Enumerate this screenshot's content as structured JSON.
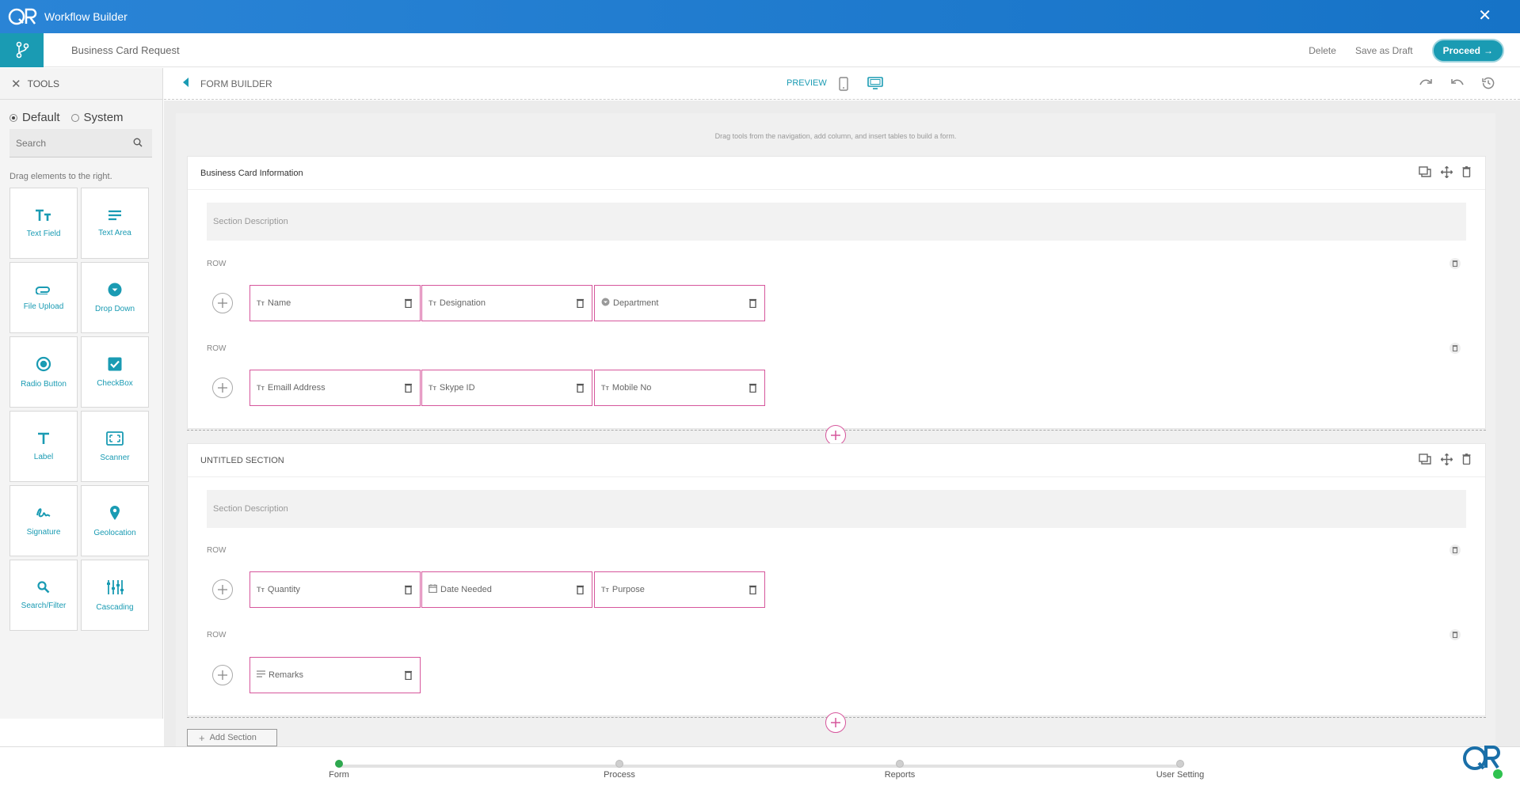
{
  "app": {
    "title": "Workflow Builder"
  },
  "header": {
    "form_name": "Business Card Request",
    "delete_label": "Delete",
    "draft_label": "Save as Draft",
    "proceed_label": "Proceed"
  },
  "tools": {
    "title": "TOOLS",
    "mode_default": "Default",
    "mode_system": "System",
    "search_placeholder": "Search",
    "hint": "Drag elements to the right.",
    "items": [
      {
        "label": "Text Field",
        "icon": "text-field-icon"
      },
      {
        "label": "Text Area",
        "icon": "text-area-icon"
      },
      {
        "label": "File Upload",
        "icon": "paperclip-icon"
      },
      {
        "label": "Drop Down",
        "icon": "dropdown-icon"
      },
      {
        "label": "Radio Button",
        "icon": "radio-icon"
      },
      {
        "label": "CheckBox",
        "icon": "checkbox-icon"
      },
      {
        "label": "Label",
        "icon": "label-icon"
      },
      {
        "label": "Scanner",
        "icon": "scanner-icon"
      },
      {
        "label": "Signature",
        "icon": "signature-icon"
      },
      {
        "label": "Geolocation",
        "icon": "location-pin-icon"
      },
      {
        "label": "Search/Filter",
        "icon": "search-icon"
      },
      {
        "label": "Cascading",
        "icon": "cascading-icon"
      }
    ]
  },
  "builder": {
    "title": "FORM BUILDER",
    "preview_label": "PREVIEW",
    "hint": "Drag tools from the navigation, add column, and insert tables to build a form."
  },
  "sections": [
    {
      "title": "Business Card Information",
      "description_placeholder": "Section Description",
      "row_label": "ROW",
      "rows": [
        [
          "Name",
          "Designation",
          "Department"
        ],
        [
          "Emaill Address",
          "Skype ID",
          "Mobile No"
        ]
      ]
    },
    {
      "title": "UNTITLED SECTION",
      "description_placeholder": "Section Description",
      "row_label": "ROW",
      "rows": [
        [
          "Quantity",
          "Date Needed",
          "Purpose"
        ],
        [
          "Remarks"
        ]
      ]
    }
  ],
  "add_section_label": "Add Section",
  "steps": [
    {
      "label": "Form",
      "active": true
    },
    {
      "label": "Process",
      "active": false
    },
    {
      "label": "Reports",
      "active": false
    },
    {
      "label": "User Setting",
      "active": false
    }
  ],
  "colors": {
    "accent": "#1a9bb3",
    "titlebar": "#1673c7",
    "field_border": "#d6569c",
    "active_step": "#2fa84f"
  }
}
